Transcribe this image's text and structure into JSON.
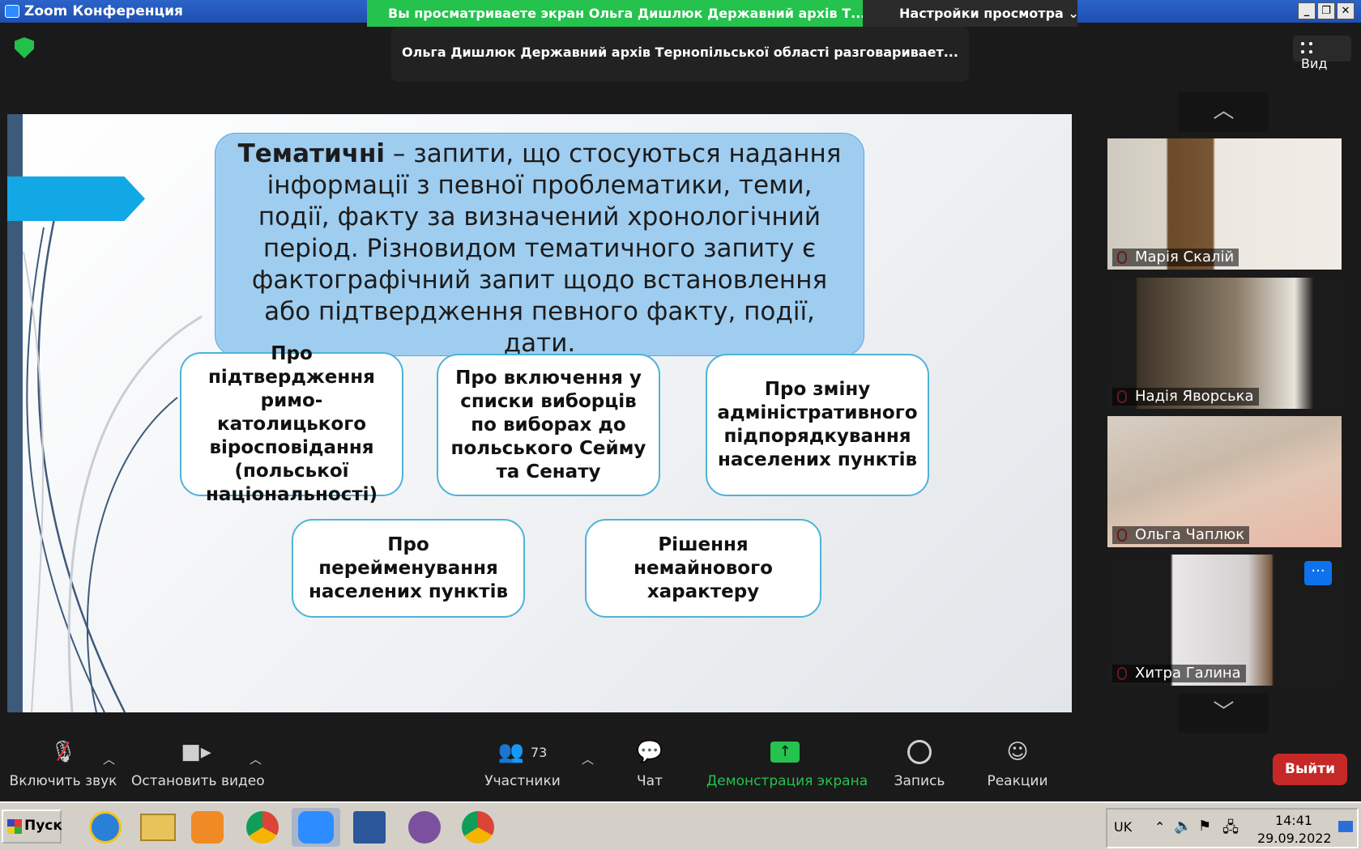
{
  "window": {
    "title": "Zoom Конференция",
    "share_banner": "Вы просматриваете экран Ольга Дишлюк Державний архів Т...",
    "view_options": "Настройки просмотра",
    "controls": [
      "_",
      "❐",
      "✕"
    ]
  },
  "active_speaker": "Ольга Дишлюк Державний архів Тернопільської області разговаривает...",
  "view_button": "Вид",
  "slide": {
    "main_bold": "Тематичні",
    "main_text": " – запити, що стосуються надання інформації з певної проблематики, теми, події, факту за визначений хронологічний період. Різновидом тематичного запиту є фактографічний запит щодо встановлення або підтвердження певного факту, події, дати.",
    "cards": [
      "Про підтвердження римо-католицького віросповідання (польської національності)",
      "Про включення у списки виборців по виборах до польського Сейму та Сенату",
      "Про зміну адміністративного підпорядкування населених пунктів",
      "Про перейменування населених пунктів",
      "Рішення немайнового характеру"
    ],
    "accent_color": "#12a8e6",
    "box_color": "#9fcdf0"
  },
  "participants": [
    {
      "name": "Марія Скалій",
      "muted": true
    },
    {
      "name": "Надія Яворська",
      "muted": true
    },
    {
      "name": "Ольга Чаплюк",
      "muted": true
    },
    {
      "name": "Хитра Галина",
      "muted": true
    }
  ],
  "toolbar": {
    "audio": "Включить звук",
    "video": "Остановить видео",
    "participants": "Участники",
    "participants_count": "73",
    "chat": "Чат",
    "share": "Демонстрация экрана",
    "record": "Запись",
    "reactions": "Реакции",
    "leave": "Выйти"
  },
  "taskbar": {
    "start": "Пуск",
    "lang": "UK",
    "time": "14:41",
    "date": "29.09.2022"
  }
}
